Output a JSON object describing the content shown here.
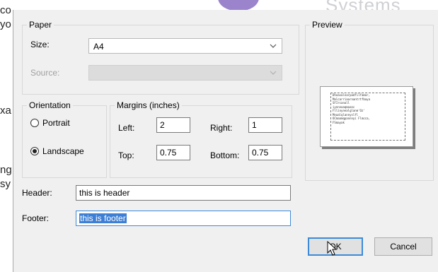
{
  "background": {
    "left_fragments": [
      "co",
      "yo",
      "xa",
      "ng",
      "sy"
    ],
    "logo_text": "Systems"
  },
  "dialog": {
    "paper": {
      "legend": "Paper",
      "size_label": "Size:",
      "size_value": "A4",
      "source_label": "Source:",
      "source_value": ""
    },
    "preview": {
      "legend": "Preview",
      "lines": [
        "Dhoavalnarpadfilfamar,",
        "Malcarriaarnantrtfbaya",
        "SFIrcanall",
        "iynnnaaqmaanc",
        "Fllinynealglanm'Oz'",
        "Mnaalqlannyslfl",
        "OCmaamqpannnyi Flmcca,",
        "FSmayak"
      ]
    },
    "orientation": {
      "legend": "Orientation",
      "portrait_label": "Portrait",
      "landscape_label": "Landscape",
      "selected": "landscape"
    },
    "margins": {
      "legend": "Margins (inches)",
      "left_label": "Left:",
      "left_value": "2",
      "right_label": "Right:",
      "right_value": "1",
      "top_label": "Top:",
      "top_value": "0.75",
      "bottom_label": "Bottom:",
      "bottom_value": "0.75"
    },
    "header_label": "Header:",
    "header_value": "this is header",
    "footer_label": "Footer:",
    "footer_value": "this is footer",
    "ok_label": "OK",
    "cancel_label": "Cancel"
  },
  "colors": {
    "dialog_bg": "#f0f0f0",
    "focus_border": "#3c8ad8",
    "selection": "#3d7fd5"
  },
  "icons": [
    "chevron-down-icon",
    "mouse-cursor-icon"
  ]
}
